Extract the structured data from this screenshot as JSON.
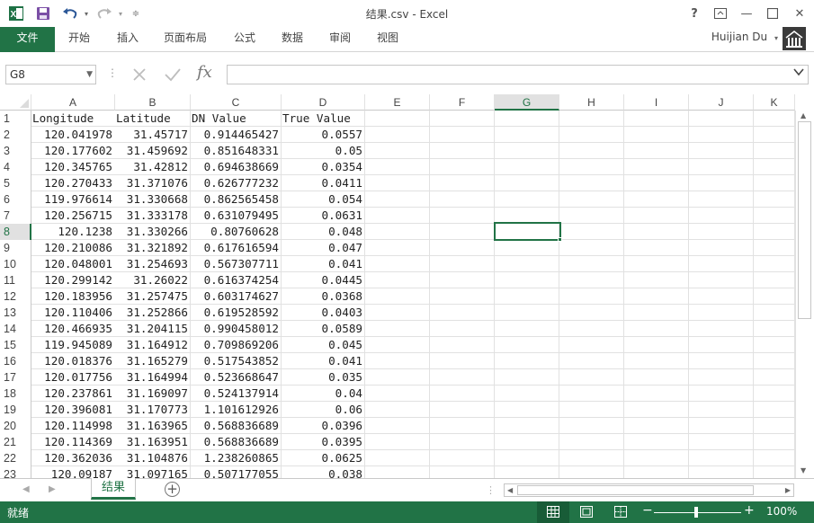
{
  "window": {
    "title": "结果.csv - Excel",
    "help": "?",
    "minimize": "—",
    "close": "✕"
  },
  "ribbon": {
    "tabs": [
      "文件",
      "开始",
      "插入",
      "页面布局",
      "公式",
      "数据",
      "审阅",
      "视图"
    ],
    "user": "Huijian Du"
  },
  "formula_bar": {
    "name_box": "G8",
    "fx": "fx",
    "value": ""
  },
  "sheet": {
    "columns": [
      "A",
      "B",
      "C",
      "D",
      "E",
      "F",
      "G",
      "H",
      "I",
      "J",
      "K"
    ],
    "rows": [
      [
        "Longitude",
        "Latitude",
        "DN Value",
        "True Value"
      ],
      [
        "120.041978",
        "31.45717",
        "0.914465427",
        "0.0557"
      ],
      [
        "120.177602",
        "31.459692",
        "0.851648331",
        "0.05"
      ],
      [
        "120.345765",
        "31.42812",
        "0.694638669",
        "0.0354"
      ],
      [
        "120.270433",
        "31.371076",
        "0.626777232",
        "0.0411"
      ],
      [
        "119.976614",
        "31.330668",
        "0.862565458",
        "0.054"
      ],
      [
        "120.256715",
        "31.333178",
        "0.631079495",
        "0.0631"
      ],
      [
        "120.1238",
        "31.330266",
        "0.80760628",
        "0.048"
      ],
      [
        "120.210086",
        "31.321892",
        "0.617616594",
        "0.047"
      ],
      [
        "120.048001",
        "31.254693",
        "0.567307711",
        "0.041"
      ],
      [
        "120.299142",
        "31.26022",
        "0.616374254",
        "0.0445"
      ],
      [
        "120.183956",
        "31.257475",
        "0.603174627",
        "0.0368"
      ],
      [
        "120.110406",
        "31.252866",
        "0.619528592",
        "0.0403"
      ],
      [
        "120.466935",
        "31.204115",
        "0.990458012",
        "0.0589"
      ],
      [
        "119.945089",
        "31.164912",
        "0.709869206",
        "0.045"
      ],
      [
        "120.018376",
        "31.165279",
        "0.517543852",
        "0.041"
      ],
      [
        "120.017756",
        "31.164994",
        "0.523668647",
        "0.035"
      ],
      [
        "120.237861",
        "31.169097",
        "0.524137914",
        "0.04"
      ],
      [
        "120.396081",
        "31.170773",
        "1.101612926",
        "0.06"
      ],
      [
        "120.114998",
        "31.163965",
        "0.568836689",
        "0.0396"
      ],
      [
        "120.114369",
        "31.163951",
        "0.568836689",
        "0.0395"
      ],
      [
        "120.362036",
        "31.104876",
        "1.238260865",
        "0.0625"
      ],
      [
        "120.09187",
        "31.097165",
        "0.507177055",
        "0.038"
      ]
    ],
    "selected_column": "G",
    "selected_row": 8
  },
  "sheet_tabs": {
    "active": "结果",
    "add": "+"
  },
  "status": {
    "ready": "就绪",
    "zoom": "100%"
  },
  "colors": {
    "accent": "#217346"
  }
}
